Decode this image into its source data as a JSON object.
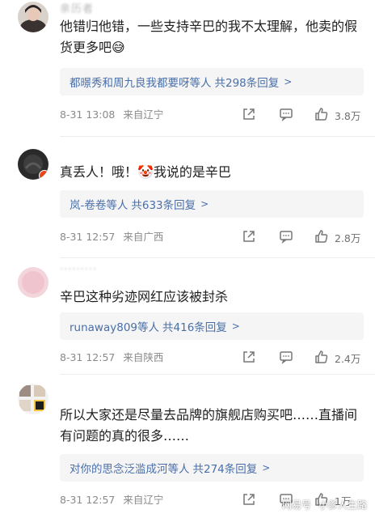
{
  "comments": [
    {
      "username": "亲历者",
      "text": "他错归他错，一些支持辛巴的我不太理解，他卖的假货更多吧😅",
      "reply_names": "都暻秀和周九良我都要呀等人",
      "reply_count": "共298条回复",
      "time": "8-31 13:08",
      "location": "来自辽宁",
      "likes": "3.8万"
    },
    {
      "username": "",
      "text": "真丢人！哦！🤡我说的是辛巴",
      "reply_names": "岚-卷卷等人",
      "reply_count": "共633条回复",
      "time": "8-31 12:57",
      "location": "来自广西",
      "likes": "2.8万"
    },
    {
      "username": "·········",
      "text": "辛巴这种劣迹网红应该被封杀",
      "reply_names": "runaway809等人",
      "reply_count": "共416条回复",
      "time": "8-31 12:57",
      "location": "来自陕西",
      "likes": "2.4万"
    },
    {
      "username": "",
      "text": "所以大家还是尽量去品牌的旗舰店购买吧……直播间有问题的真的很多……",
      "reply_names": "对你的思念泛滥成河等人",
      "reply_count": "共274条回复",
      "time": "8-31 12:57",
      "location": "来自辽宁",
      "likes": "1万"
    }
  ],
  "watermark": {
    "left": "网易号",
    "right": "小爹人生路"
  },
  "icons": [
    "share-icon",
    "comment-icon",
    "like-icon",
    "reply-arrow-icon"
  ]
}
